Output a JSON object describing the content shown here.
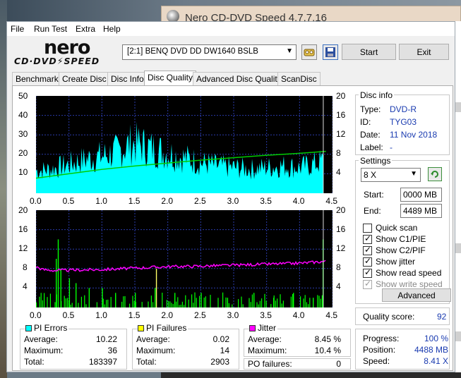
{
  "background_window": {
    "title": "Nero CD-DVD Speed 4.7.7.16"
  },
  "menu": [
    "File",
    "Run Test",
    "Extra",
    "Help"
  ],
  "logo": {
    "brand": "nero",
    "product": "CD·DVD⚡SPEED"
  },
  "toolbar": {
    "drive": "[2:1]   BENQ DVD DD DW1640 BSLB",
    "start_label": "Start",
    "exit_label": "Exit",
    "eject_icon": "eject-icon",
    "save_icon": "save-icon"
  },
  "tabs": [
    "Benchmark",
    "Create Disc",
    "Disc Info",
    "Disc Quality",
    "Advanced Disc Quality",
    "ScanDisc"
  ],
  "active_tab": "Disc Quality",
  "disc_info": {
    "title": "Disc info",
    "rows": [
      {
        "label": "Type:",
        "value": "DVD-R"
      },
      {
        "label": "ID:",
        "value": "TYG03"
      },
      {
        "label": "Date:",
        "value": "11 Nov 2018"
      },
      {
        "label": "Label:",
        "value": "-"
      }
    ]
  },
  "settings": {
    "title": "Settings",
    "speed": "8 X",
    "start_label": "Start:",
    "start_value": "0000 MB",
    "end_label": "End:",
    "end_value": "4489 MB",
    "checks": [
      {
        "label": "Quick scan",
        "checked": false,
        "disabled": false
      },
      {
        "label": "Show C1/PIE",
        "checked": true,
        "disabled": false
      },
      {
        "label": "Show C2/PIF",
        "checked": true,
        "disabled": false
      },
      {
        "label": "Show jitter",
        "checked": true,
        "disabled": false
      },
      {
        "label": "Show read speed",
        "checked": true,
        "disabled": false
      },
      {
        "label": "Show write speed",
        "checked": true,
        "disabled": true
      }
    ],
    "advanced_label": "Advanced"
  },
  "quality": {
    "label": "Quality score:",
    "value": "92"
  },
  "progress": {
    "rows": [
      {
        "label": "Progress:",
        "value": "100 %"
      },
      {
        "label": "Position:",
        "value": "4488 MB"
      },
      {
        "label": "Speed:",
        "value": "8.41 X"
      }
    ]
  },
  "stats": {
    "pi_errors": {
      "title": "PI Errors",
      "color": "#00ffff",
      "rows": [
        {
          "label": "Average:",
          "value": "10.22"
        },
        {
          "label": "Maximum:",
          "value": "36"
        },
        {
          "label": "Total:",
          "value": "183397"
        }
      ]
    },
    "pi_failures": {
      "title": "PI Failures",
      "color": "#ffff00",
      "rows": [
        {
          "label": "Average:",
          "value": "0.02"
        },
        {
          "label": "Maximum:",
          "value": "14"
        },
        {
          "label": "Total:",
          "value": "2903"
        }
      ]
    },
    "jitter": {
      "title": "Jitter",
      "color": "#ff00ff",
      "rows": [
        {
          "label": "Average:",
          "value": "8.45 %"
        },
        {
          "label": "Maximum:",
          "value": "10.4 %"
        }
      ]
    },
    "po_failures": {
      "label": "PO failures:",
      "value": "0"
    }
  },
  "chart_data": [
    {
      "type": "area",
      "xlim": [
        0,
        4.5
      ],
      "x_ticks": [
        "0.0",
        "0.5",
        "1.0",
        "1.5",
        "2.0",
        "2.5",
        "3.0",
        "3.5",
        "4.0",
        "4.5"
      ],
      "y_left_ticks": [
        "50",
        "40",
        "30",
        "20",
        "10"
      ],
      "y_right_ticks": [
        "20",
        "16",
        "12",
        "8",
        "4"
      ],
      "ylim_left": [
        0,
        50
      ],
      "ylim_right": [
        0,
        20
      ],
      "grid": true,
      "series": [
        {
          "color": "#00ffff",
          "x": [
            0.0,
            0.25,
            0.5,
            0.75,
            1.0,
            1.25,
            1.4,
            1.5,
            1.6,
            1.75,
            2.0,
            2.25,
            2.5,
            2.75,
            3.0,
            3.25,
            3.5,
            3.75,
            4.0,
            4.2,
            4.35
          ],
          "values": [
            14,
            15,
            18,
            21,
            23,
            26,
            30,
            31,
            30,
            28,
            25,
            22,
            19,
            17,
            16,
            15,
            16,
            17,
            16,
            18,
            20
          ]
        },
        {
          "color": "#00cc00",
          "x": [
            0.0,
            0.5,
            1.0,
            1.5,
            2.0,
            2.5,
            3.0,
            3.5,
            4.0,
            4.4
          ],
          "values": [
            3.1,
            4.0,
            4.9,
            5.6,
            6.2,
            6.8,
            7.3,
            7.8,
            8.2,
            8.6
          ]
        }
      ]
    },
    {
      "type": "bar",
      "xlim": [
        0,
        4.5
      ],
      "x_ticks": [
        "0.0",
        "0.5",
        "1.0",
        "1.5",
        "2.0",
        "2.5",
        "3.0",
        "3.5",
        "4.0",
        "4.5"
      ],
      "y_left_ticks": [
        "20",
        "16",
        "12",
        "8",
        "4"
      ],
      "y_right_ticks": [
        "20",
        "16",
        "12",
        "8",
        "4"
      ],
      "ylim": [
        0,
        20
      ],
      "grid": true,
      "series": [
        {
          "color": "#00ff00",
          "x": [
            0.3,
            0.33,
            0.37,
            0.5,
            0.6,
            0.8,
            1.0,
            1.2,
            1.5,
            1.8,
            1.82,
            2.1,
            2.5,
            2.9,
            3.3,
            3.6,
            3.9,
            4.2,
            4.35
          ],
          "values": [
            10,
            14,
            8,
            6,
            5,
            4,
            4,
            3,
            3,
            4,
            8,
            3,
            3,
            2,
            3,
            2,
            3,
            2,
            14
          ]
        },
        {
          "color": "#ff00ff",
          "x": [
            0.0,
            0.1,
            0.3,
            0.6,
            1.0,
            1.5,
            2.0,
            2.5,
            3.0,
            3.5,
            4.0,
            4.4
          ],
          "values": [
            8.4,
            7.8,
            7.6,
            7.7,
            7.8,
            8.1,
            8.4,
            8.5,
            8.7,
            8.9,
            9.1,
            9.5
          ]
        }
      ]
    }
  ]
}
